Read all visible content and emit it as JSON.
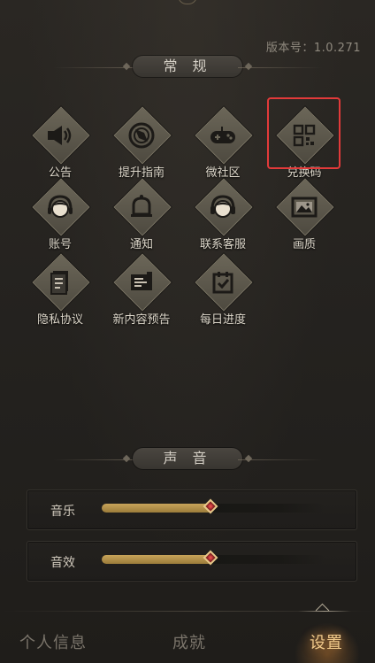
{
  "version": "版本号：1.0.271",
  "sections": {
    "general": "常 规",
    "sound": "声 音"
  },
  "items": [
    {
      "label": "公告",
      "icon": "speaker-icon"
    },
    {
      "label": "提升指南",
      "icon": "compass-icon"
    },
    {
      "label": "微社区",
      "icon": "gamepad-icon"
    },
    {
      "label": "兑换码",
      "icon": "qr-code-icon"
    },
    {
      "label": "账号",
      "icon": "account-avatar-icon"
    },
    {
      "label": "通知",
      "icon": "bell-icon"
    },
    {
      "label": "联系客服",
      "icon": "headset-icon"
    },
    {
      "label": "画质",
      "icon": "picture-icon"
    },
    {
      "label": "隐私协议",
      "icon": "document-icon"
    },
    {
      "label": "新内容预告",
      "icon": "notice-board-icon"
    },
    {
      "label": "每日进度",
      "icon": "calendar-check-icon"
    }
  ],
  "sliders": [
    {
      "label": "音乐",
      "level": 0.49
    },
    {
      "label": "音效",
      "level": 0.49
    }
  ],
  "nav": [
    {
      "label": "个人信息",
      "active": false
    },
    {
      "label": "成就",
      "active": false
    },
    {
      "label": "设置",
      "active": true
    }
  ],
  "colors": {
    "accent": "#c8a45a",
    "highlight": "#e23a3a",
    "active_tab": "#f0c98a"
  }
}
